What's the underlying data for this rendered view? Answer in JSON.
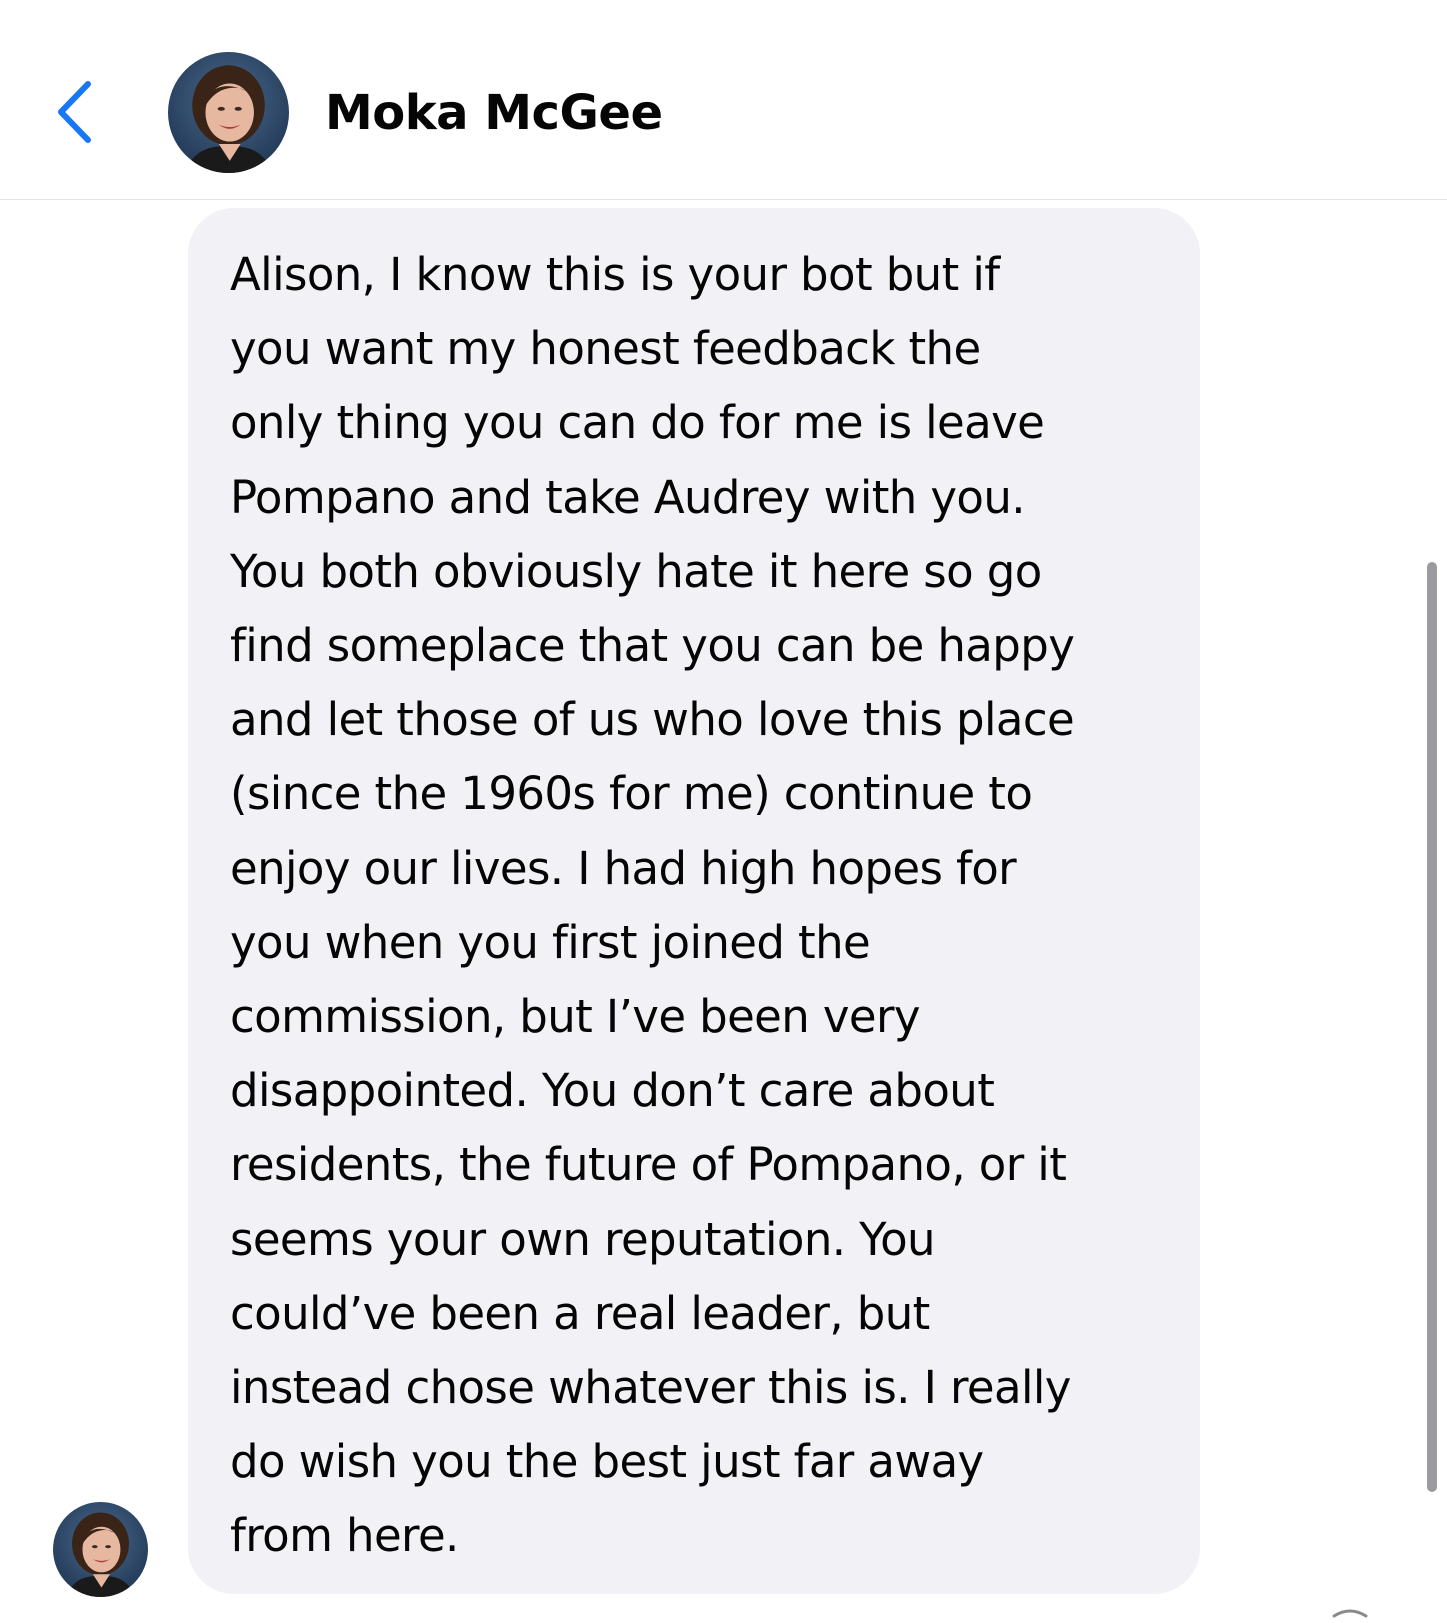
{
  "header": {
    "back_icon": "chevron-left-icon",
    "contact_name": "Moka McGee",
    "accent_color": "#1877f2"
  },
  "conversation": {
    "messages": [
      {
        "direction": "incoming",
        "text": "Alison, I know this is your bot but if\nyou want my honest feedback the\nonly thing you can do for me is leave\nPompano and take Audrey with you.\nYou both obviously hate it here so go\nfind someplace that you can be happy\nand let those of us who love this place\n(since the 1960s for me) continue to\nenjoy our lives. I had high hopes for\nyou when you first joined the\ncommission, but I’ve been very\ndisappointed. You don’t care about\nresidents, the future of Pompano, or it\nseems your own reputation. You\ncould’ve been a real leader, but\ninstead chose whatever this is. I really\ndo wish you the best just far away\nfrom here.",
        "bubble_color": "#f1f1f6"
      }
    ]
  }
}
